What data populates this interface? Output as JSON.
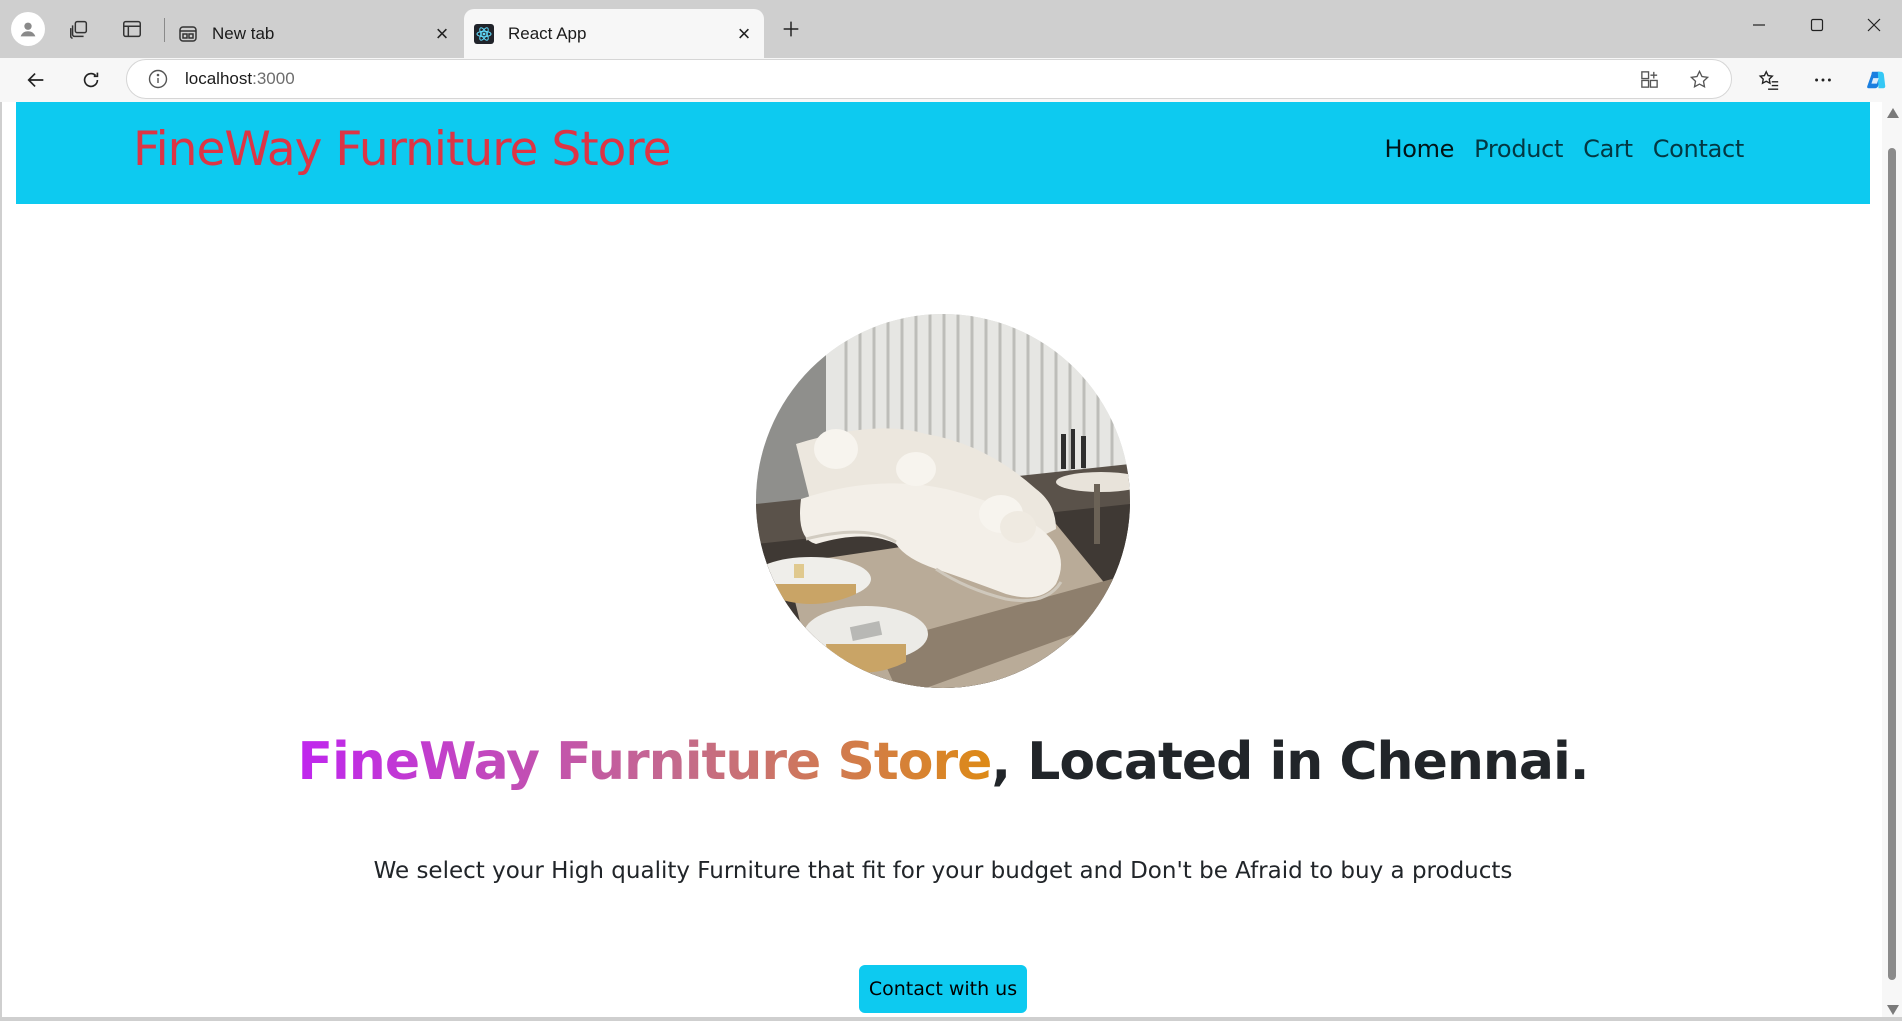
{
  "browser": {
    "tabs": [
      {
        "title": "New tab",
        "favicon": "new-tab-page-icon",
        "active": false
      },
      {
        "title": "React App",
        "favicon": "react-logo-icon",
        "active": true
      }
    ],
    "address": {
      "host": "localhost",
      "port": ":3000"
    },
    "colors": {
      "titlebar": "#cfcfcf",
      "toolbar": "#f7f7f7"
    }
  },
  "site": {
    "brand": "FineWay Furniture Store",
    "nav": [
      "Home",
      "Product",
      "Cart",
      "Contact"
    ],
    "hero": {
      "headline_gradient": "FineWay Furniture Store",
      "headline_rest": ", Located in Chennai.",
      "lead": "We select your High quality Furniture that fit for your budget and Don't be Afraid to buy a products",
      "cta": "Contact with us",
      "image_alt": "curved white sofa in living room"
    },
    "colors": {
      "navbar": "#0dcaf0",
      "brand": "#dc3545",
      "button": "#0dcaf0",
      "gradient_start": "#c026ef",
      "gradient_end": "#dd8a16"
    }
  }
}
